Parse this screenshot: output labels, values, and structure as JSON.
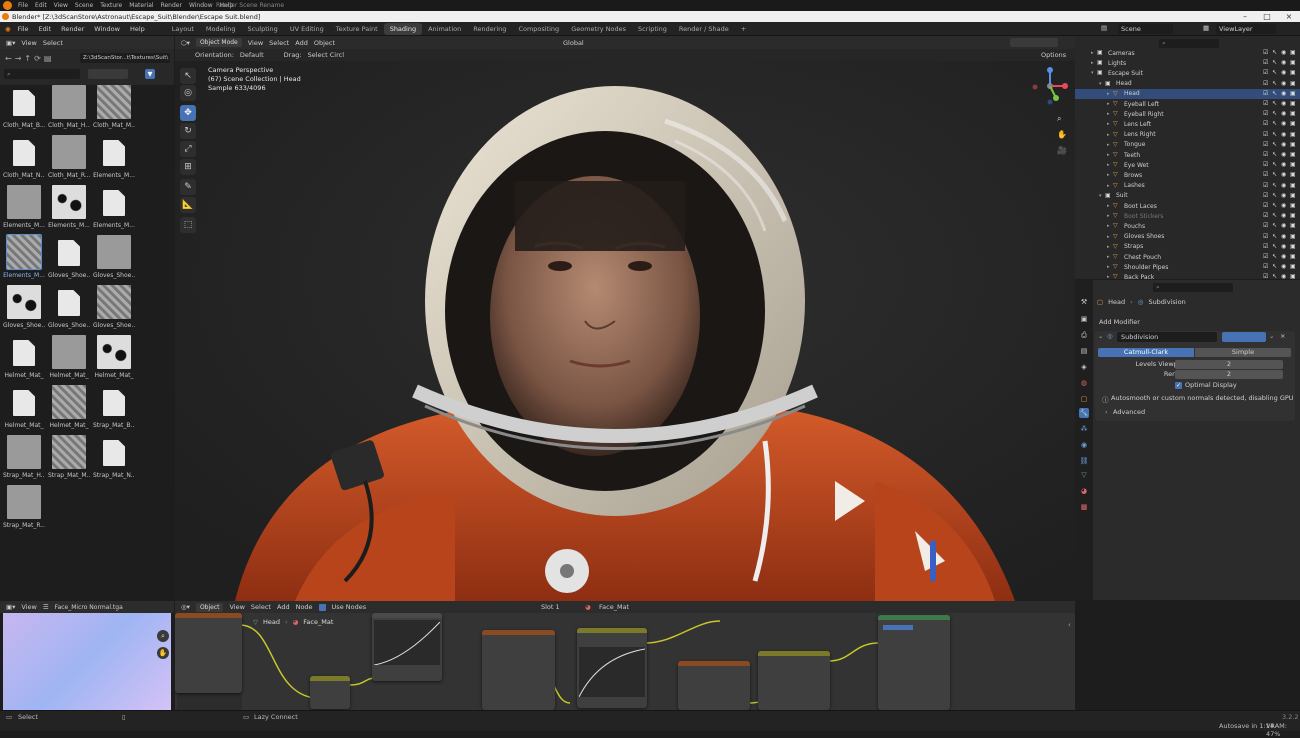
{
  "os_menu": [
    "File",
    "Edit",
    "View",
    "Scene",
    "Texture",
    "Material",
    "Render",
    "Window",
    "Help"
  ],
  "os_title": "Render Scene Rename",
  "window_title": "Blender* [Z:\\3dScanStore\\Astronaut\\Escape_Suit\\Blender\\Escape Suit.blend]",
  "menu": [
    "File",
    "Edit",
    "Render",
    "Window",
    "Help"
  ],
  "workspaces": [
    "Layout",
    "Modeling",
    "Sculpting",
    "UV Editing",
    "Texture Paint",
    "Shading",
    "Animation",
    "Rendering",
    "Compositing",
    "Geometry Nodes",
    "Scripting",
    "Render / Shade"
  ],
  "active_workspace": "Shading",
  "scene_name": "Scene",
  "viewlayer_name": "ViewLayer",
  "file_browser": {
    "menus": [
      "View",
      "Select"
    ],
    "path": "Z:\\3dScanStor...t\\Textures\\Suit\\",
    "items": [
      {
        "label": "Cloth_Mat_B...",
        "kind": "doc"
      },
      {
        "label": "Cloth_Mat_H...",
        "kind": "gray"
      },
      {
        "label": "Cloth_Mat_M...",
        "kind": "noise"
      },
      {
        "label": "Cloth_Mat_N...",
        "kind": "doc"
      },
      {
        "label": "Cloth_Mat_R...",
        "kind": "gray"
      },
      {
        "label": "Elements_M...",
        "kind": "doc"
      },
      {
        "label": "Elements_M...",
        "kind": "gray"
      },
      {
        "label": "Elements_M...",
        "kind": "spots"
      },
      {
        "label": "Elements_M...",
        "kind": "doc"
      },
      {
        "label": "Elements_M...",
        "kind": "noise"
      },
      {
        "label": "Gloves_Shoe...",
        "kind": "doc"
      },
      {
        "label": "Gloves_Shoe...",
        "kind": "gray"
      },
      {
        "label": "Gloves_Shoe...",
        "kind": "spots"
      },
      {
        "label": "Gloves_Shoe...",
        "kind": "doc"
      },
      {
        "label": "Gloves_Shoe...",
        "kind": "noise"
      },
      {
        "label": "Helmet_Mat_",
        "kind": "doc"
      },
      {
        "label": "Helmet_Mat_",
        "kind": "gray"
      },
      {
        "label": "Helmet_Mat_",
        "kind": "spots"
      },
      {
        "label": "Helmet_Mat_",
        "kind": "doc"
      },
      {
        "label": "Helmet_Mat_",
        "kind": "noise"
      },
      {
        "label": "Strap_Mat_B...",
        "kind": "doc"
      },
      {
        "label": "Strap_Mat_H...",
        "kind": "gray"
      },
      {
        "label": "Strap_Mat_M...",
        "kind": "noise"
      },
      {
        "label": "Strap_Mat_N...",
        "kind": "doc"
      },
      {
        "label": "Strap_Mat_R...",
        "kind": "gray"
      }
    ],
    "selected_index": 9
  },
  "viewport": {
    "mode": "Object Mode",
    "menus": [
      "View",
      "Select",
      "Add",
      "Object"
    ],
    "orientation_label": "Orientation:",
    "orientation_value": "Default",
    "drag_label": "Drag:",
    "drag_value": "Select Circl",
    "transform": "Global",
    "options": "Options",
    "overlay_line1": "Camera Perspective",
    "overlay_line2": "(67) Scene Collection | Head",
    "overlay_line3": "Sample 633/4096"
  },
  "outliner": {
    "rows": [
      {
        "label": "Cameras",
        "indent": 1,
        "type": "collection"
      },
      {
        "label": "Lights",
        "indent": 1,
        "type": "collection"
      },
      {
        "label": "Escape Suit",
        "indent": 1,
        "type": "collection",
        "open": true
      },
      {
        "label": "Head",
        "indent": 2,
        "type": "collection",
        "open": true
      },
      {
        "label": "Head",
        "indent": 3,
        "type": "mesh",
        "selected": true
      },
      {
        "label": "Eyeball Left",
        "indent": 3,
        "type": "mesh"
      },
      {
        "label": "Eyeball Right",
        "indent": 3,
        "type": "mesh"
      },
      {
        "label": "Lens Left",
        "indent": 3,
        "type": "mesh"
      },
      {
        "label": "Lens Right",
        "indent": 3,
        "type": "mesh"
      },
      {
        "label": "Tongue",
        "indent": 3,
        "type": "mesh"
      },
      {
        "label": "Teeth",
        "indent": 3,
        "type": "mesh"
      },
      {
        "label": "Eye Wet",
        "indent": 3,
        "type": "mesh"
      },
      {
        "label": "Brows",
        "indent": 3,
        "type": "mesh"
      },
      {
        "label": "Lashes",
        "indent": 3,
        "type": "mesh"
      },
      {
        "label": "Suit",
        "indent": 2,
        "type": "collection",
        "open": true
      },
      {
        "label": "Boot Laces",
        "indent": 3,
        "type": "mesh"
      },
      {
        "label": "Boot Stickers",
        "indent": 3,
        "type": "mesh",
        "dim": true
      },
      {
        "label": "Pouchs",
        "indent": 3,
        "type": "mesh"
      },
      {
        "label": "Gloves Shoes",
        "indent": 3,
        "type": "mesh"
      },
      {
        "label": "Straps",
        "indent": 3,
        "type": "mesh"
      },
      {
        "label": "Chest Pouch",
        "indent": 3,
        "type": "mesh"
      },
      {
        "label": "Shoulder Pipes",
        "indent": 3,
        "type": "mesh"
      },
      {
        "label": "Back Pack",
        "indent": 3,
        "type": "mesh"
      }
    ]
  },
  "properties": {
    "breadcrumb_object": "Head",
    "breadcrumb_modifier": "Subdivision",
    "add_modifier": "Add Modifier",
    "modifier_name": "Subdivision",
    "type_options": [
      "Catmull-Clark",
      "Simple"
    ],
    "active_type": "Catmull-Clark",
    "levels_viewport_label": "Levels Viewport",
    "levels_viewport_value": "2",
    "render_label": "Render",
    "render_value": "2",
    "optimal_display_label": "Optimal Display",
    "optimal_display": true,
    "warning": "Autosmooth or custom normals detected, disabling GPU subdivisio",
    "advanced": "Advanced"
  },
  "image_editor": {
    "menus": [
      "View"
    ],
    "image_name": "Face_Micro Normal.tga"
  },
  "node_editor": {
    "mode": "Object",
    "menus": [
      "View",
      "Select",
      "Add",
      "Node"
    ],
    "use_nodes_label": "Use Nodes",
    "slot": "Slot 1",
    "material": "Face_Mat",
    "breadcrumb_object": "Head",
    "breadcrumb_material": "Face_Mat"
  },
  "status": {
    "left": "Select",
    "middle": "Lazy Connect",
    "right": "Autosave in 1:14",
    "vram": "VRAM: 47%",
    "version": "3.2.2"
  },
  "colors": {
    "accent": "#4772b3",
    "suit_orange": "#c8491f",
    "mesh_green": "#59b86a",
    "collection_white": "#dddddd",
    "object_orange": "#e8a048"
  }
}
